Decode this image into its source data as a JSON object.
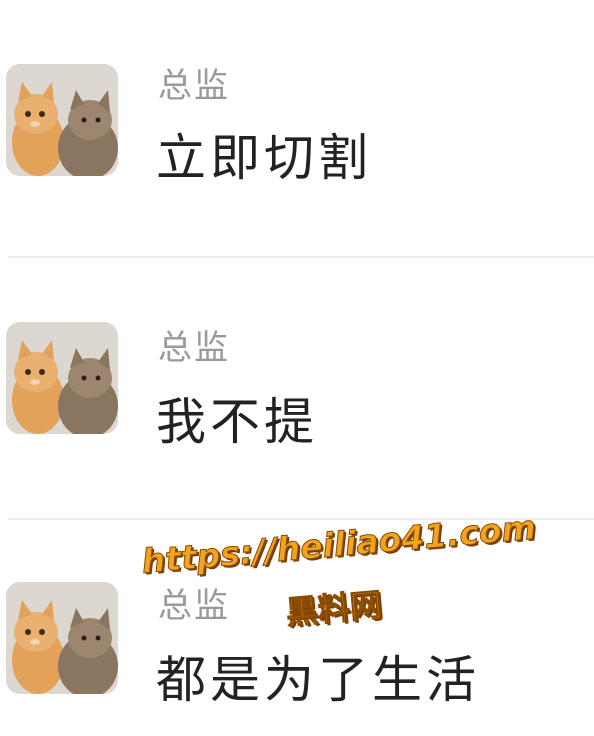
{
  "messages": [
    {
      "sender": "总监",
      "text": "立即切割",
      "avatar_icon": "two-kittens-avatar"
    },
    {
      "sender": "总监",
      "text": "我不提",
      "avatar_icon": "two-kittens-avatar"
    },
    {
      "sender": "总监",
      "text": "都是为了生活",
      "avatar_icon": "two-kittens-avatar"
    }
  ],
  "watermark": {
    "url": "https://heiliao41.com",
    "name": "黑料网",
    "color": "#f2a51a"
  }
}
